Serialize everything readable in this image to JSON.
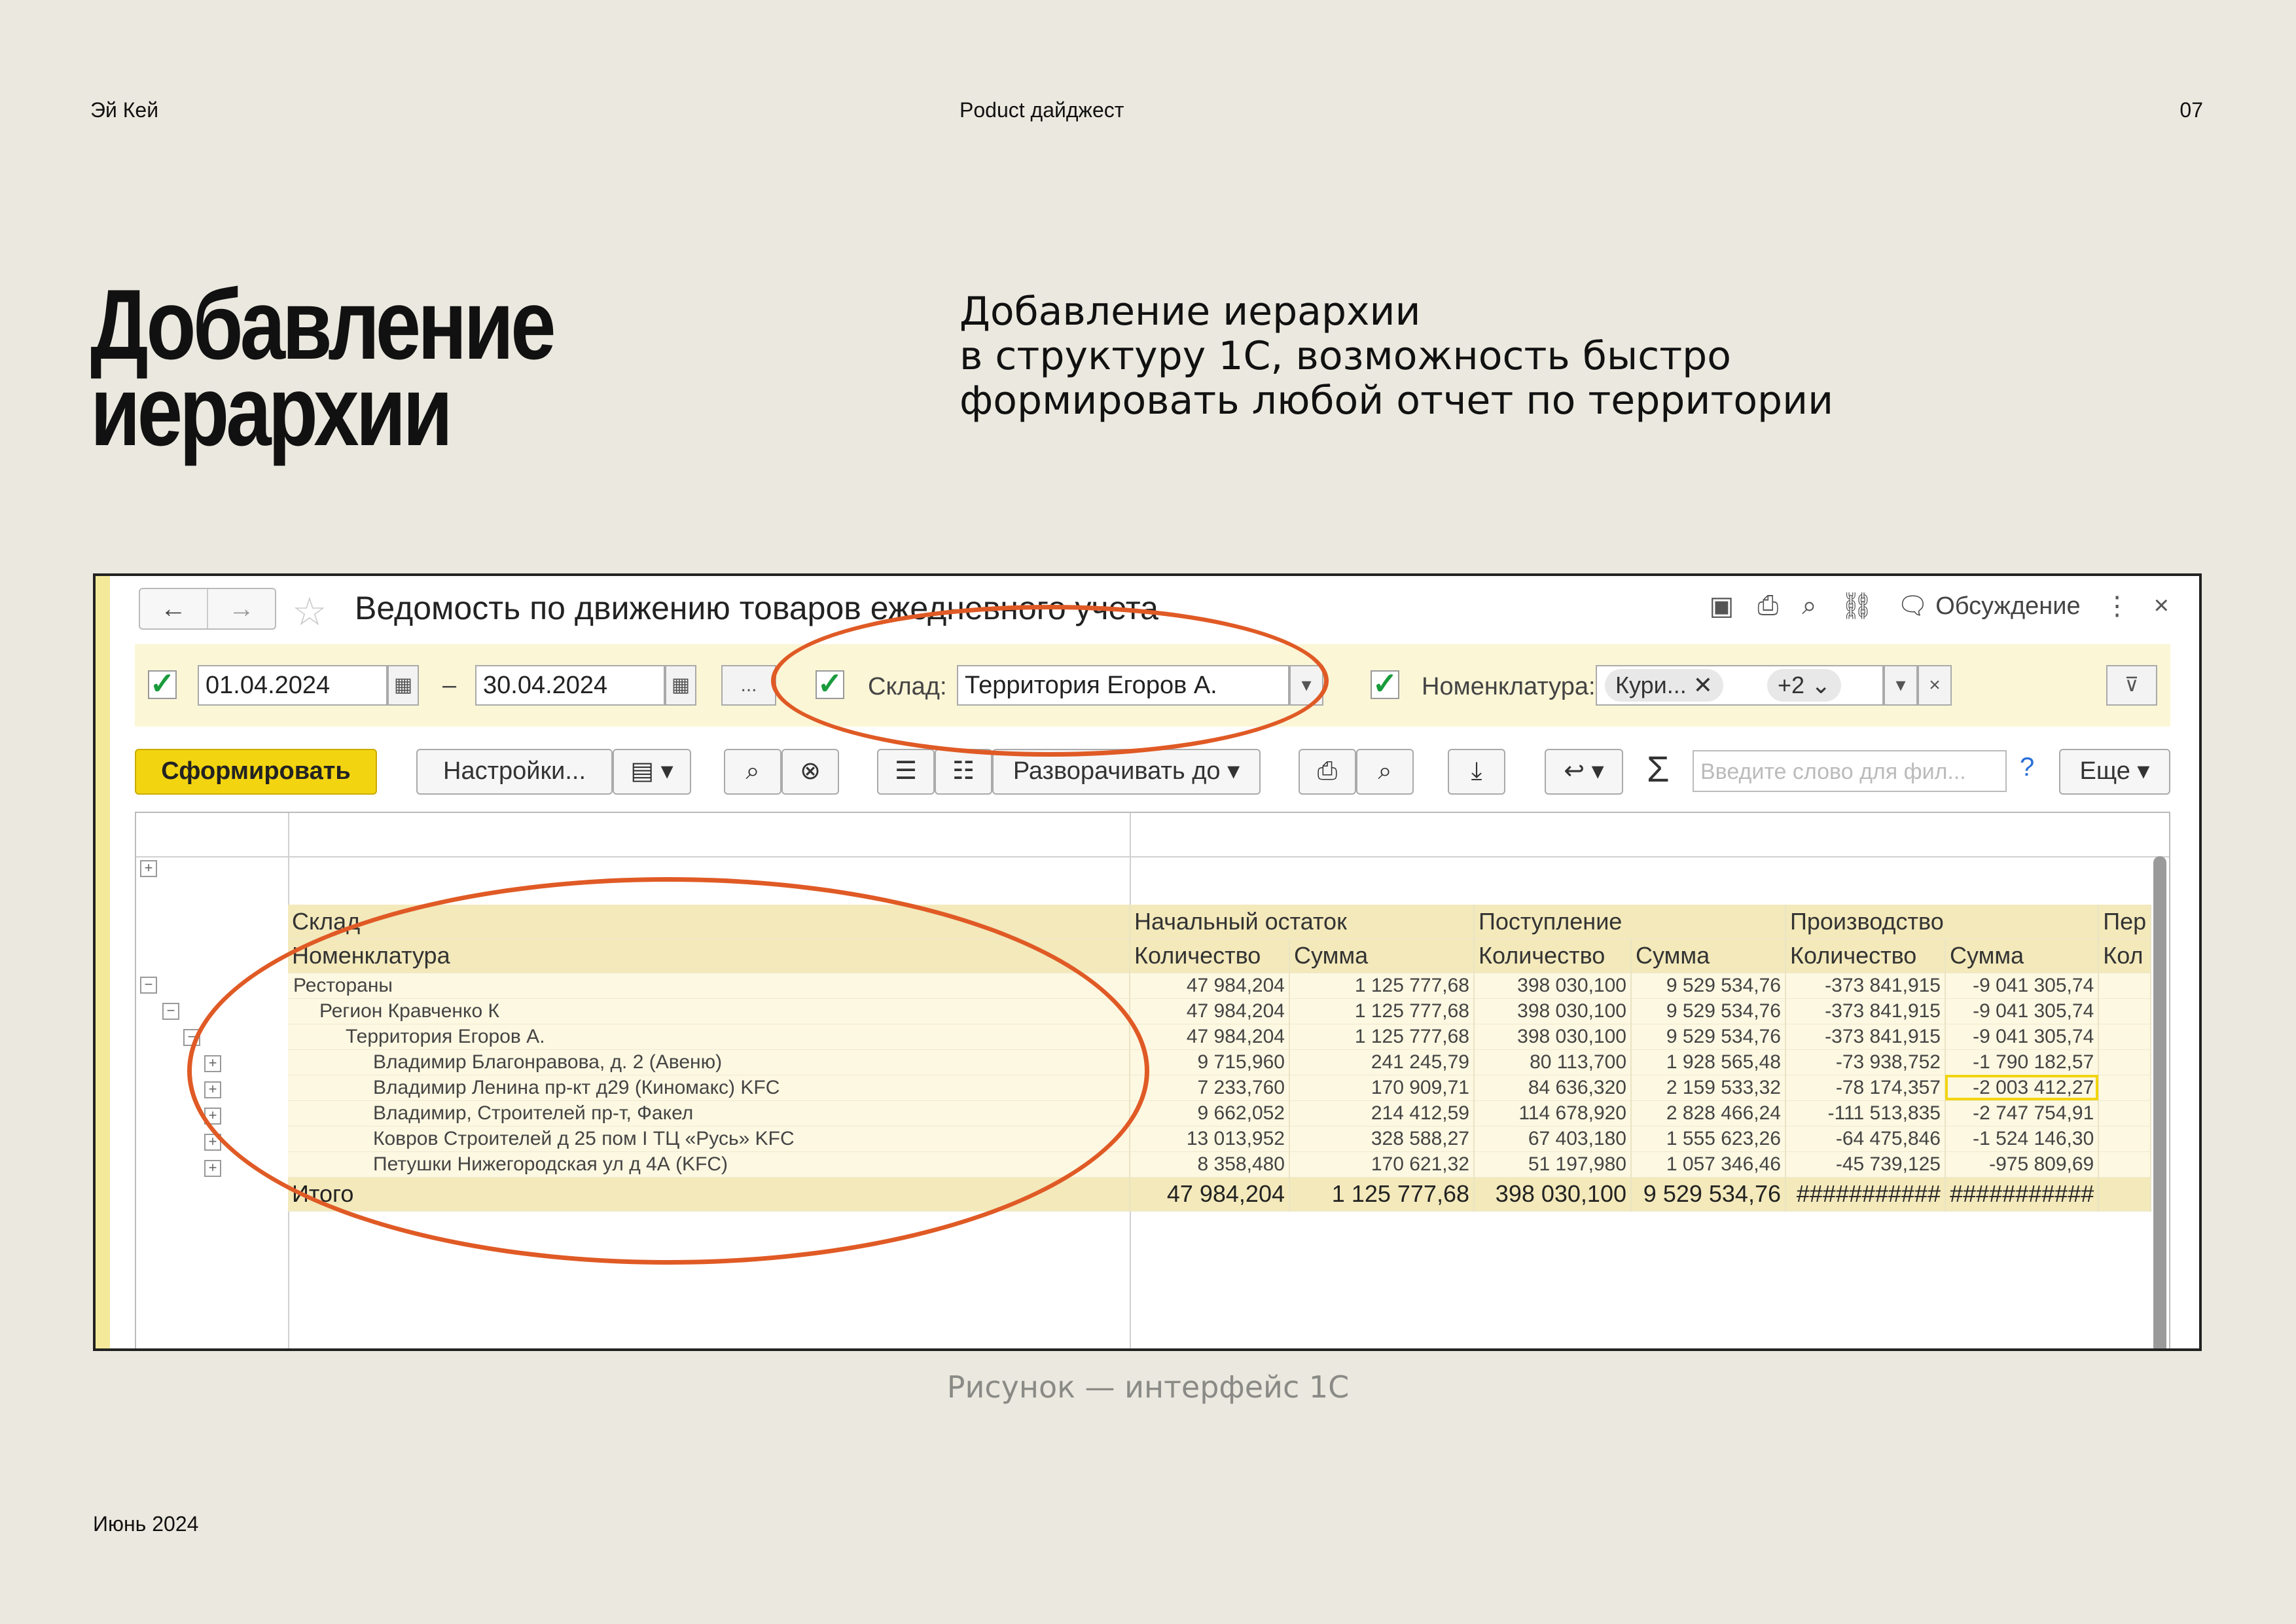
{
  "header": {
    "left": "Эй Кей",
    "center": "Poduct дайджест",
    "page": "07"
  },
  "title": {
    "line1": "Добавление",
    "line2": "иерархии"
  },
  "subtitle": {
    "line1": "Добавление иерархии",
    "line2": "в структуру 1С, возможность быстро",
    "line3": "формировать любой отчет по территории"
  },
  "caption": "Рисунок — интерфейс 1С",
  "footer": "Июнь 2024",
  "window": {
    "title": "Ведомость по движению товаров ежедневного учета",
    "discussion": "Обсуждение",
    "filters": {
      "date_from": "01.04.2024",
      "date_sep": "–",
      "date_to": "30.04.2024",
      "ellipsis": "...",
      "warehouse_label": "Склад:",
      "warehouse_value": "Территория Егоров А.",
      "nomenclature_label": "Номенклатура:",
      "nomenclature_tag": "Кури...",
      "nomenclature_more": "+2"
    },
    "toolbar": {
      "generate": "Сформировать",
      "settings": "Настройки...",
      "expand_to": "Разворачивать до",
      "search_placeholder": "Введите слово для фил...",
      "help": "?",
      "more": "Еще"
    },
    "report": {
      "head1": [
        "Склад",
        "Начальный остаток",
        "Поступление",
        "Производство",
        "Пер"
      ],
      "head2": [
        "Номенклатура",
        "Количество",
        "Сумма",
        "Количество",
        "Сумма",
        "Количество",
        "Сумма",
        "Кол"
      ],
      "rows": [
        {
          "name": "Рестораны",
          "level": 0,
          "v": [
            "47 984,204",
            "1 125 777,68",
            "398 030,100",
            "9 529 534,76",
            "-373 841,915",
            "-9 041 305,74"
          ]
        },
        {
          "name": "Регион Кравченко К",
          "level": 1,
          "v": [
            "47 984,204",
            "1 125 777,68",
            "398 030,100",
            "9 529 534,76",
            "-373 841,915",
            "-9 041 305,74"
          ]
        },
        {
          "name": "Территория Егоров А.",
          "level": 2,
          "v": [
            "47 984,204",
            "1 125 777,68",
            "398 030,100",
            "9 529 534,76",
            "-373 841,915",
            "-9 041 305,74"
          ]
        },
        {
          "name": "Владимир Благонравова, д. 2 (Авеню)",
          "level": 3,
          "v": [
            "9 715,960",
            "241 245,79",
            "80 113,700",
            "1 928 565,48",
            "-73 938,752",
            "-1 790 182,57"
          ]
        },
        {
          "name": "Владимир Ленина пр-кт д29 (Киномакс) KFC",
          "level": 3,
          "v": [
            "7 233,760",
            "170 909,71",
            "84 636,320",
            "2 159 533,32",
            "-78 174,357",
            "-2 003 412,27"
          ]
        },
        {
          "name": "Владимир, Строителей пр-т, Факел",
          "level": 3,
          "v": [
            "9 662,052",
            "214 412,59",
            "114 678,920",
            "2 828 466,24",
            "-111 513,835",
            "-2 747 754,91"
          ]
        },
        {
          "name": "Ковров Строителей д 25 пом I ТЦ «Русь» KFC",
          "level": 3,
          "v": [
            "13 013,952",
            "328 588,27",
            "67 403,180",
            "1 555 623,26",
            "-64 475,846",
            "-1 524 146,30"
          ]
        },
        {
          "name": "Петушки Нижегородская ул д 4А (KFC)",
          "level": 3,
          "v": [
            "8 358,480",
            "170 621,32",
            "51 197,980",
            "1 057 346,46",
            "-45 739,125",
            "-975 809,69"
          ]
        }
      ],
      "total": {
        "label": "Итого",
        "v": [
          "47 984,204",
          "1 125 777,68",
          "398 030,100",
          "9 529 534,76",
          "###########",
          "###########"
        ]
      }
    }
  },
  "colors": {
    "background": "#ebe9df",
    "highlight": "#e05a25",
    "accent": "#f2d411"
  }
}
